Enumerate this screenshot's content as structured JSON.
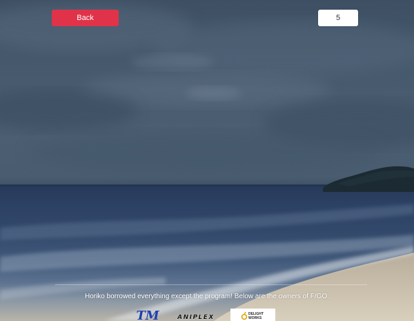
{
  "toolbar": {
    "back_label": "Back",
    "count_value": "5"
  },
  "footer": {
    "credits_text": "Horiko borrowed everything except the program! Below are the owners of F/GO.",
    "logos": {
      "tm": "TM",
      "aniplex": "ANIPLEX",
      "delightworks_line1": "DELIGHT",
      "delightworks_line2": "WORKS"
    }
  },
  "colors": {
    "accent": "#e0334a",
    "sky": "#4b5e72",
    "sea": "#2c4164",
    "sand": "#c9c1b2"
  }
}
